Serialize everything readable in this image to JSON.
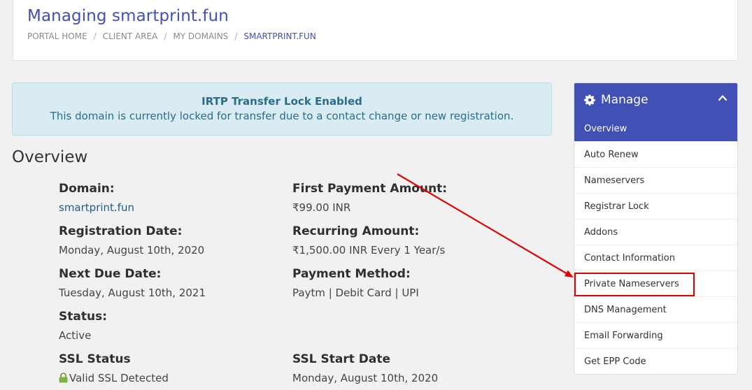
{
  "header": {
    "title": "Managing smartprint.fun",
    "breadcrumb": [
      "PORTAL HOME",
      "CLIENT AREA",
      "MY DOMAINS",
      "SMARTPRINT.FUN"
    ]
  },
  "alert": {
    "title": "IRTP Transfer Lock Enabled",
    "text": "This domain is currently locked for transfer due to a contact change or new registration."
  },
  "overview": {
    "title": "Overview",
    "domain_label": "Domain:",
    "domain_value": "smartprint.fun",
    "reg_date_label": "Registration Date:",
    "reg_date_value": "Monday, August 10th, 2020",
    "next_due_label": "Next Due Date:",
    "next_due_value": "Tuesday, August 10th, 2021",
    "status_label": "Status:",
    "status_value": "Active",
    "ssl_status_label": "SSL Status",
    "ssl_status_value": "Valid SSL Detected",
    "first_payment_label": "First Payment Amount:",
    "first_payment_value": "₹99.00 INR",
    "recurring_label": "Recurring Amount:",
    "recurring_value": "₹1,500.00 INR Every 1 Year/s",
    "payment_method_label": "Payment Method:",
    "payment_method_value": "Paytm | Debit Card | UPI",
    "ssl_start_label": "SSL Start Date",
    "ssl_start_value": "Monday, August 10th, 2020"
  },
  "manage": {
    "title": "Manage",
    "items": [
      "Overview",
      "Auto Renew",
      "Nameservers",
      "Registrar Lock",
      "Addons",
      "Contact Information",
      "Private Nameservers",
      "DNS Management",
      "Email Forwarding",
      "Get EPP Code"
    ]
  },
  "colors": {
    "brand": "#4150b5",
    "alert_bg": "#d9ecf3",
    "annotation": "#e00000"
  },
  "icons": {
    "manage": "gear-icon",
    "collapse": "chevron-up-icon",
    "ssl": "lock-icon"
  }
}
